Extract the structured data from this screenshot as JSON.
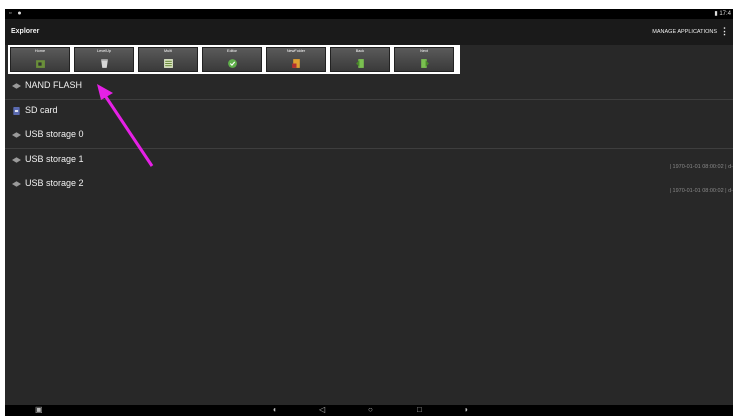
{
  "statusbar": {
    "left": "▫ ●",
    "right": "▮ 17:4"
  },
  "app": {
    "title": "Explorer",
    "manage_label": "MANAGE APPLICATIONS",
    "overflow": "⋮"
  },
  "toolbar": {
    "buttons": [
      {
        "label": "Home",
        "icon": "home-icon",
        "color": "#6a8f3a"
      },
      {
        "label": "LevelUp",
        "icon": "level-up-icon",
        "color": "#cfcfcf"
      },
      {
        "label": "Multi",
        "icon": "multi-select-icon",
        "color": "#9ab16a"
      },
      {
        "label": "Editor",
        "icon": "editor-icon",
        "color": "#5fb04a"
      },
      {
        "label": "NewFolder",
        "icon": "new-folder-icon",
        "color": "#e0a030"
      },
      {
        "label": "Back",
        "icon": "back-icon",
        "color": "#7ac050"
      },
      {
        "label": "Next",
        "icon": "next-icon",
        "color": "#7ac050"
      }
    ]
  },
  "storage": [
    {
      "label": "NAND FLASH",
      "icon": "drive-icon"
    },
    {
      "label": "SD card",
      "icon": "sd-card-icon"
    },
    {
      "label": "USB storage 0",
      "icon": "usb-drive-icon"
    },
    {
      "label": "USB storage 1",
      "icon": "usb-drive-icon"
    },
    {
      "label": "USB storage 2",
      "icon": "usb-drive-icon"
    }
  ],
  "meta": [
    "| 1970-01-01 08:00:02 | d-",
    "| 1970-01-01 08:00:02 | d-"
  ],
  "navbar": {
    "items": [
      "screenshot-icon",
      "volume-down-icon",
      "back-nav-icon",
      "home-nav-icon",
      "recents-icon",
      "volume-up-icon"
    ]
  },
  "colors": {
    "accent_arrow": "#e620e6",
    "background": "#282828"
  }
}
